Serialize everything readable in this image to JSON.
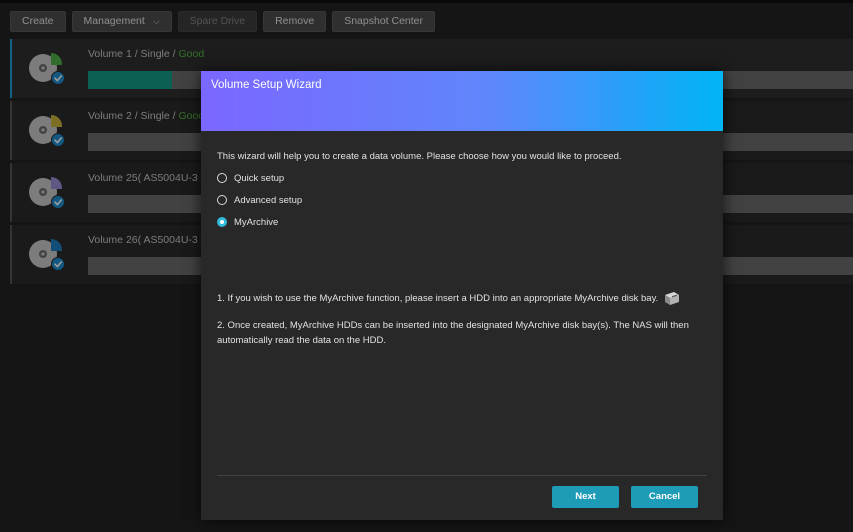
{
  "toolbar": {
    "create_label": "Create",
    "management_label": "Management",
    "spare_drive_label": "Spare Drive",
    "remove_label": "Remove",
    "snapshot_label": "Snapshot Center"
  },
  "volumes": [
    {
      "name": "Volume 1",
      "sep1": " / ",
      "raid": "Single",
      "sep2": " / ",
      "status": "Good",
      "usage_fraction": 0.11,
      "pie_color": "#4fb04a"
    },
    {
      "name": "Volume 2",
      "sep1": " / ",
      "raid": "Single",
      "sep2": " / ",
      "status": "Good",
      "usage_fraction": 0.0,
      "pie_color": "#c8b33a"
    },
    {
      "name": "Volume 25( AS5004U-3 )",
      "sep1": "",
      "raid": "",
      "sep2": "",
      "status": "",
      "usage_fraction": 0.0,
      "pie_color": "#9a8fd6"
    },
    {
      "name": "Volume 26( AS5004U-3 )",
      "sep1": "",
      "raid": "",
      "sep2": "",
      "status": "",
      "usage_fraction": 0.0,
      "pie_color": "#1f7fc2"
    }
  ],
  "wizard": {
    "title": "Volume Setup Wizard",
    "intro": "This wizard will help you to create a data volume. Please choose how you would like to proceed.",
    "options": [
      {
        "label": "Quick setup",
        "selected": false
      },
      {
        "label": "Advanced setup",
        "selected": false
      },
      {
        "label": "MyArchive",
        "selected": true
      }
    ],
    "note1": "1. If you wish to use the MyArchive function, please insert a HDD into an appropriate MyArchive disk bay.",
    "note2": "2. Once created, MyArchive HDDs can be inserted into the designated MyArchive disk bay(s). The NAS will then automatically read the data on the HDD.",
    "next_label": "Next",
    "cancel_label": "Cancel"
  },
  "colors": {
    "accent": "#1e9bb7",
    "good": "#55b540",
    "header_start": "#7b67ff",
    "header_end": "#00b4f6"
  },
  "icons": {
    "volume": "disk-pie-icon",
    "status_check": "check-badge-icon",
    "hdd": "hdd-icon",
    "dropdown": "chevron-down-icon"
  }
}
